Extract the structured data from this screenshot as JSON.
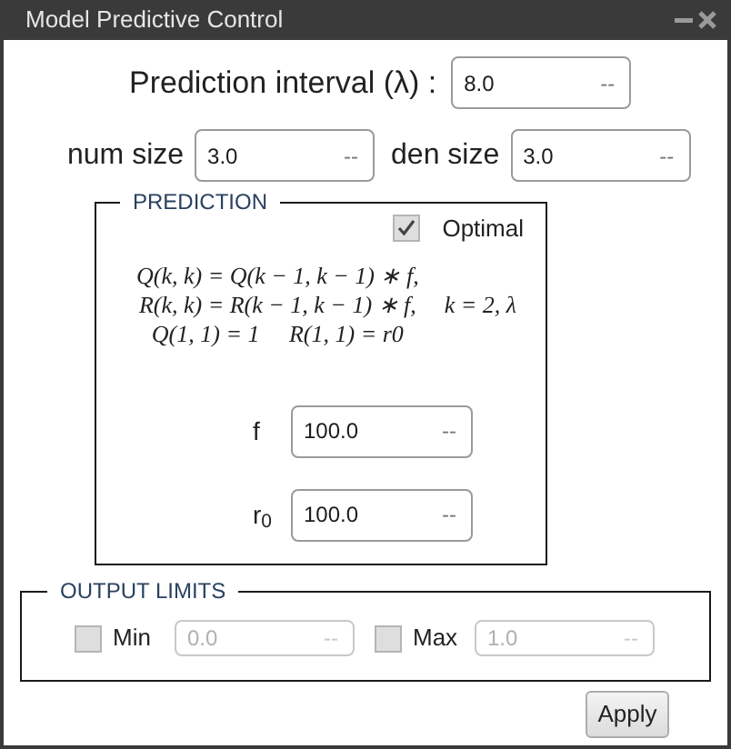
{
  "window": {
    "title": "Model Predictive Control"
  },
  "prediction_interval": {
    "label": "Prediction interval (λ) :",
    "value": "8.0",
    "unit": "--"
  },
  "sizes": [
    {
      "label": "num size",
      "value": "3.0",
      "unit": "--"
    },
    {
      "label": "den size",
      "value": "3.0",
      "unit": "--"
    }
  ],
  "prediction": {
    "legend": "PREDICTION",
    "optimal": {
      "label": "Optimal",
      "checked": true
    },
    "formula_lines": [
      "Q(k, k) = Q(k − 1, k − 1) ∗ f,",
      "R(k, k) = R(k − 1, k − 1) ∗ f,",
      "Q(1, 1) = 1     R(1, 1) = r0"
    ],
    "formula_note": "k = 2, λ",
    "fields": [
      {
        "label": "f",
        "value": "100.0",
        "unit": "--"
      },
      {
        "label": "r$_{0}$",
        "value": "100.0",
        "unit": "--"
      }
    ]
  },
  "output_limits": {
    "legend": "OUTPUT LIMITS",
    "limits": [
      {
        "label": "Min",
        "checked": false,
        "value": "0.0",
        "unit": "--",
        "disabled": true
      },
      {
        "label": "Max",
        "checked": false,
        "value": "1.0",
        "unit": "--",
        "disabled": true
      }
    ]
  },
  "apply_button": "Apply"
}
